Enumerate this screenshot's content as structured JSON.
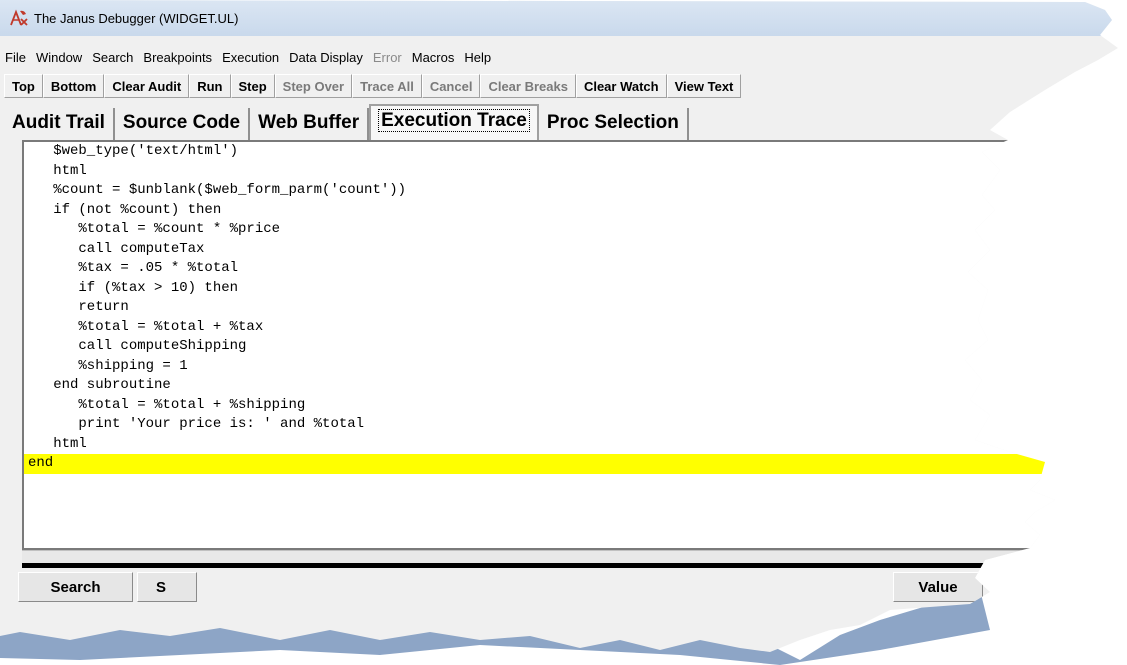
{
  "window": {
    "title": "The Janus Debugger (WIDGET.UL)"
  },
  "menu": {
    "items": [
      {
        "label": "File",
        "enabled": true
      },
      {
        "label": "Window",
        "enabled": true
      },
      {
        "label": "Search",
        "enabled": true
      },
      {
        "label": "Breakpoints",
        "enabled": true
      },
      {
        "label": "Execution",
        "enabled": true
      },
      {
        "label": "Data Display",
        "enabled": true
      },
      {
        "label": "Error",
        "enabled": false
      },
      {
        "label": "Macros",
        "enabled": true
      },
      {
        "label": "Help",
        "enabled": true
      }
    ]
  },
  "toolbar": {
    "buttons": [
      {
        "label": "Top",
        "enabled": true
      },
      {
        "label": "Bottom",
        "enabled": true
      },
      {
        "label": "Clear Audit",
        "enabled": true
      },
      {
        "label": "Run",
        "enabled": true
      },
      {
        "label": "Step",
        "enabled": true
      },
      {
        "label": "Step Over",
        "enabled": false
      },
      {
        "label": "Trace All",
        "enabled": false
      },
      {
        "label": "Cancel",
        "enabled": false
      },
      {
        "label": "Clear Breaks",
        "enabled": false
      },
      {
        "label": "Clear Watch",
        "enabled": true
      },
      {
        "label": "View Text",
        "enabled": true
      }
    ]
  },
  "tabs": {
    "items": [
      {
        "label": "Audit Trail",
        "active": false
      },
      {
        "label": "Source Code",
        "active": false
      },
      {
        "label": "Web Buffer",
        "active": false
      },
      {
        "label": "Execution Trace",
        "active": true
      },
      {
        "label": "Proc Selection",
        "active": false
      }
    ]
  },
  "editor": {
    "highlight_color": "#ffff00",
    "lines": [
      {
        "text": "   $web_type('text/html')",
        "highlight": false
      },
      {
        "text": "   html",
        "highlight": false
      },
      {
        "text": "   %count = $unblank($web_form_parm('count'))",
        "highlight": false
      },
      {
        "text": "   if (not %count) then",
        "highlight": false
      },
      {
        "text": "      %total = %count * %price",
        "highlight": false
      },
      {
        "text": "      call computeTax",
        "highlight": false
      },
      {
        "text": "      %tax = .05 * %total",
        "highlight": false
      },
      {
        "text": "      if (%tax > 10) then",
        "highlight": false
      },
      {
        "text": "      return",
        "highlight": false
      },
      {
        "text": "      %total = %total + %tax",
        "highlight": false
      },
      {
        "text": "      call computeShipping",
        "highlight": false
      },
      {
        "text": "      %shipping = 1",
        "highlight": false
      },
      {
        "text": "   end subroutine",
        "highlight": false
      },
      {
        "text": "      %total = %total + %shipping",
        "highlight": false
      },
      {
        "text": "      print 'Your price is: ' and %total",
        "highlight": false
      },
      {
        "text": "   html",
        "highlight": false
      },
      {
        "text": "end",
        "highlight": true
      }
    ]
  },
  "bottom": {
    "search_label": "Search",
    "partial_label": "S",
    "value_label": "Value"
  }
}
